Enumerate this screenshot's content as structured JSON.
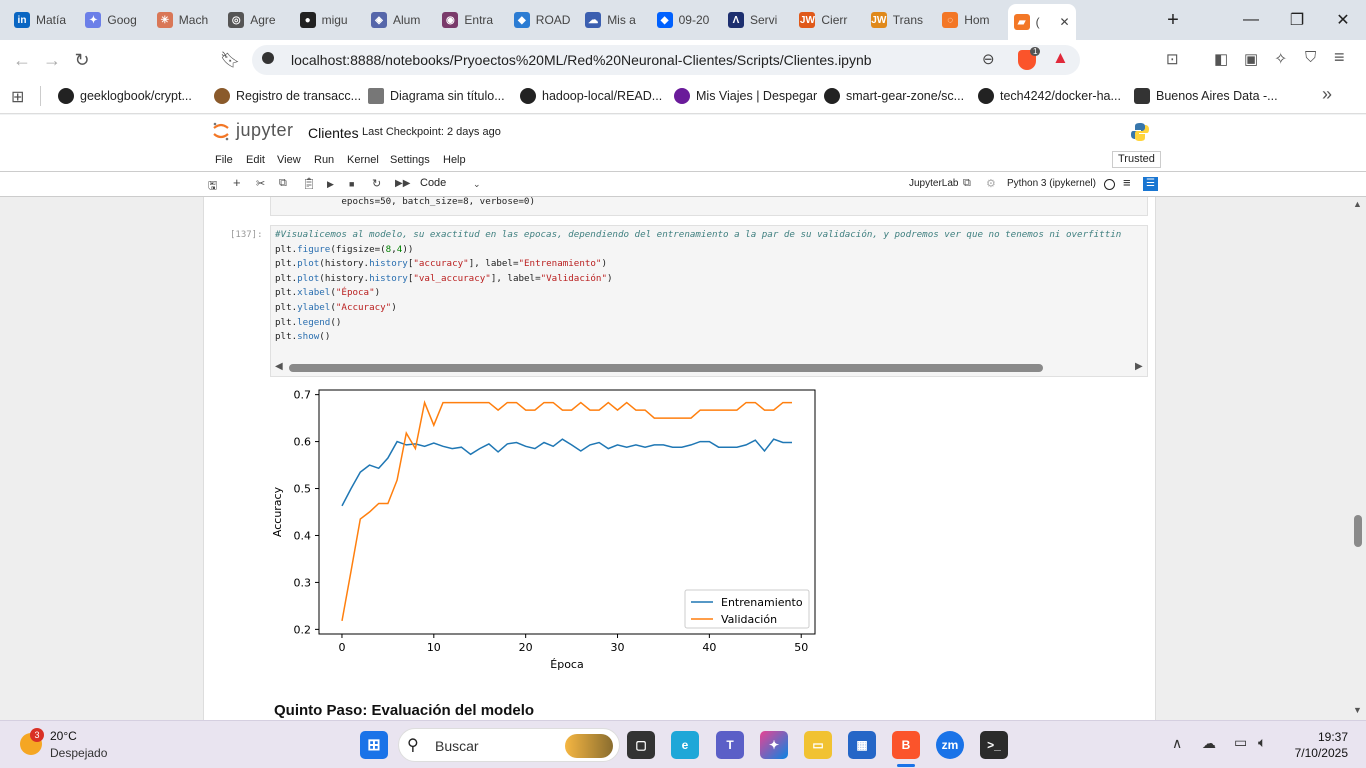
{
  "tabs": [
    {
      "label": "Matía",
      "icon": "linkedin-icon",
      "color": "#0a66c2",
      "glyph": "in"
    },
    {
      "label": "Goog",
      "icon": "gemini-icon",
      "color": "#6b7fe8",
      "glyph": "✦"
    },
    {
      "label": "Mach",
      "icon": "claude-icon",
      "color": "#d97757",
      "glyph": "✳"
    },
    {
      "label": "Agre",
      "icon": "chatgpt-icon",
      "color": "#555555",
      "glyph": "◎"
    },
    {
      "label": "migu",
      "icon": "github-icon",
      "color": "#222222",
      "glyph": "●"
    },
    {
      "label": "Alum",
      "icon": "alumni-icon",
      "color": "#5566aa",
      "glyph": "◈"
    },
    {
      "label": "Entra",
      "icon": "entra-icon",
      "color": "#7a3b6b",
      "glyph": "◉"
    },
    {
      "label": "ROAD",
      "icon": "azure-icon",
      "color": "#2b7cd3",
      "glyph": "◆"
    },
    {
      "label": "Mis a",
      "icon": "cloud-icon",
      "color": "#3b5fb0",
      "glyph": "☁"
    },
    {
      "label": "09-20",
      "icon": "dropbox-icon",
      "color": "#0061fe",
      "glyph": "◆"
    },
    {
      "label": "Servi",
      "icon": "atlassian-icon",
      "color": "#1d2f6f",
      "glyph": "Λ"
    },
    {
      "label": "Cierr",
      "icon": "jw-icon",
      "color": "#e0591a",
      "glyph": "JW"
    },
    {
      "label": "Trans",
      "icon": "jw-icon",
      "color": "#e0891a",
      "glyph": "JW"
    },
    {
      "label": "Hom",
      "icon": "jupyter-icon",
      "color": "#f37726",
      "glyph": "◌"
    },
    {
      "label": "(",
      "icon": "notebook-icon",
      "color": "#f37726",
      "glyph": "▰",
      "active": true
    }
  ],
  "window": {
    "minimize": "—",
    "maximize": "❐",
    "close": "✕",
    "new_tab": "+",
    "tab_close": "✕"
  },
  "address": {
    "url": "localhost:8888/notebooks/Pryoectos%20ML/Red%20Neuronal-Clientes/Scripts/Clientes.ipynb",
    "brave_badge": "1"
  },
  "bookmarks": [
    {
      "label": "geeklogbook/crypt...",
      "icon": "github-icon"
    },
    {
      "label": "Registro de transacc...",
      "icon": "globe-icon"
    },
    {
      "label": "Diagrama sin título...",
      "icon": "diagram-icon"
    },
    {
      "label": "hadoop-local/READ...",
      "icon": "github-icon"
    },
    {
      "label": "Mis Viajes | Despegar",
      "icon": "despegar-icon"
    },
    {
      "label": "smart-gear-zone/sc...",
      "icon": "github-icon"
    },
    {
      "label": "tech4242/docker-ha...",
      "icon": "github-icon"
    },
    {
      "label": "Buenos Aires Data -...",
      "icon": "car-icon"
    }
  ],
  "jupyter": {
    "logo": "jupyter",
    "notebook_name": "Clientes",
    "checkpoint": "Last Checkpoint: 2 days ago",
    "trusted": "Trusted",
    "menus": [
      "File",
      "Edit",
      "View",
      "Run",
      "Kernel",
      "Settings",
      "Help"
    ],
    "cell_type": "Code",
    "jupyterlab_link": "JupyterLab",
    "kernel": "Python 3 (ipykernel)"
  },
  "cells": {
    "prev_tail": "            epochs=50, batch_size=8, verbose=0)",
    "prompt": "[137]:",
    "comment": "#Visualicemos al modelo, su exactitud en las epocas, dependiendo del entrenamiento a la par de su validación, y podremos ver que no tenemos ni overfittin",
    "line1_a": "plt.",
    "line1_b": "figure",
    "line1_c": "(figsize=(",
    "line1_d": "8",
    "line1_e": ",",
    "line1_f": "4",
    "line1_g": "))",
    "line2_a": "plt.",
    "line2_b": "plot",
    "line2_c": "(history.",
    "line2_d": "history",
    "line2_e": "[",
    "line2_f": "\"accuracy\"",
    "line2_g": "], label=",
    "line2_h": "\"Entrenamiento\"",
    "line2_i": ")",
    "line3_a": "plt.",
    "line3_b": "plot",
    "line3_c": "(history.",
    "line3_d": "history",
    "line3_e": "[",
    "line3_f": "\"val_accuracy\"",
    "line3_g": "], label=",
    "line3_h": "\"Validación\"",
    "line3_i": ")",
    "line4_a": "plt.",
    "line4_b": "xlabel",
    "line4_c": "(",
    "line4_d": "\"Época\"",
    "line4_e": ")",
    "line5_a": "plt.",
    "line5_b": "ylabel",
    "line5_c": "(",
    "line5_d": "\"Accuracy\"",
    "line5_e": ")",
    "line6_a": "plt.",
    "line6_b": "legend",
    "line6_c": "()",
    "line7_a": "plt.",
    "line7_b": "show",
    "line7_c": "()",
    "heading": "Quinto Paso: Evaluación del modelo"
  },
  "chart_data": {
    "type": "line",
    "title": "",
    "xlabel": "Época",
    "ylabel": "Accuracy",
    "xlim": [
      -2.5,
      51.5
    ],
    "ylim": [
      0.2,
      0.7
    ],
    "xticks": [
      0,
      10,
      20,
      30,
      40,
      50
    ],
    "yticks": [
      0.2,
      0.3,
      0.4,
      0.5,
      0.6,
      0.7
    ],
    "legend_position": "lower right",
    "x": [
      0,
      1,
      2,
      3,
      4,
      5,
      6,
      7,
      8,
      9,
      10,
      11,
      12,
      13,
      14,
      15,
      16,
      17,
      18,
      19,
      20,
      21,
      22,
      23,
      24,
      25,
      26,
      27,
      28,
      29,
      30,
      31,
      32,
      33,
      34,
      35,
      36,
      37,
      38,
      39,
      40,
      41,
      42,
      43,
      44,
      45,
      46,
      47,
      48,
      49
    ],
    "series": [
      {
        "name": "Entrenamiento",
        "color": "#1f77b4",
        "values": [
          0.463,
          0.5,
          0.535,
          0.55,
          0.543,
          0.565,
          0.6,
          0.593,
          0.595,
          0.59,
          0.597,
          0.59,
          0.585,
          0.588,
          0.573,
          0.585,
          0.595,
          0.578,
          0.595,
          0.598,
          0.59,
          0.585,
          0.598,
          0.59,
          0.605,
          0.593,
          0.58,
          0.593,
          0.598,
          0.585,
          0.593,
          0.588,
          0.593,
          0.588,
          0.593,
          0.593,
          0.588,
          0.588,
          0.593,
          0.6,
          0.6,
          0.588,
          0.588,
          0.588,
          0.593,
          0.603,
          0.58,
          0.605,
          0.598,
          0.598
        ]
      },
      {
        "name": "Validación",
        "color": "#ff7f0e",
        "values": [
          0.218,
          0.325,
          0.435,
          0.45,
          0.468,
          0.468,
          0.518,
          0.618,
          0.585,
          0.683,
          0.635,
          0.683,
          0.683,
          0.683,
          0.683,
          0.683,
          0.683,
          0.667,
          0.683,
          0.683,
          0.667,
          0.667,
          0.683,
          0.683,
          0.667,
          0.667,
          0.683,
          0.667,
          0.667,
          0.683,
          0.667,
          0.683,
          0.667,
          0.667,
          0.65,
          0.65,
          0.65,
          0.65,
          0.65,
          0.667,
          0.667,
          0.667,
          0.667,
          0.667,
          0.683,
          0.683,
          0.667,
          0.667,
          0.683,
          0.683
        ]
      }
    ]
  },
  "taskbar": {
    "weather_temp": "20°C",
    "weather_desc": "Despejado",
    "weather_badge": "3",
    "search_placeholder": "Buscar",
    "time": "19:37",
    "date": "7/10/2025"
  }
}
